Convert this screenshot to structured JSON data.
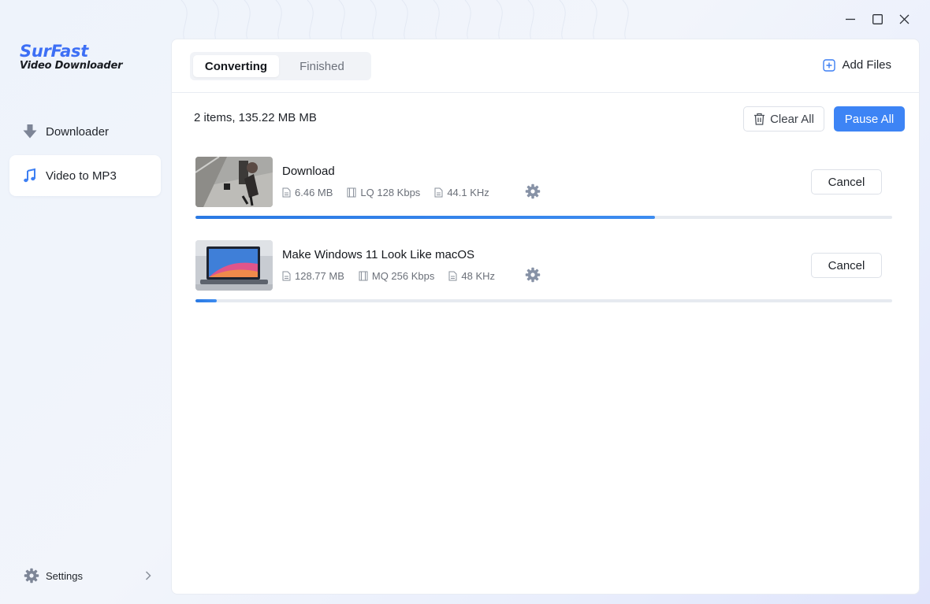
{
  "app": {
    "name": "SurFast",
    "subtitle": "Video Downloader"
  },
  "window_controls": [
    "minimize-icon",
    "maximize-icon",
    "close-icon"
  ],
  "sidebar": {
    "items": [
      {
        "label": "Downloader",
        "icon": "download-arrow-icon",
        "active": false
      },
      {
        "label": "Video to MP3",
        "icon": "music-note-icon",
        "active": true
      }
    ],
    "settings_label": "Settings"
  },
  "main": {
    "tabs": [
      {
        "label": "Converting",
        "active": true
      },
      {
        "label": "Finished",
        "active": false
      }
    ],
    "add_files_label": "Add Files",
    "summary": "2 items, 135.22 MB MB",
    "clear_all_label": "Clear All",
    "pause_all_label": "Pause All",
    "tasks": [
      {
        "title": "Download",
        "size": "6.46 MB",
        "quality": "LQ 128 Kbps",
        "sample_rate": "44.1 KHz",
        "cancel_label": "Cancel",
        "progress_percent": 66
      },
      {
        "title": "Make Windows 11 Look Like macOS",
        "size": "128.77 MB",
        "quality": "MQ 256 Kbps",
        "sample_rate": "48 KHz",
        "cancel_label": "Cancel",
        "progress_percent": 3
      }
    ]
  },
  "colors": {
    "accent": "#3d84f5",
    "logo": "#3d6ff5",
    "progress": "#2a79e3"
  }
}
